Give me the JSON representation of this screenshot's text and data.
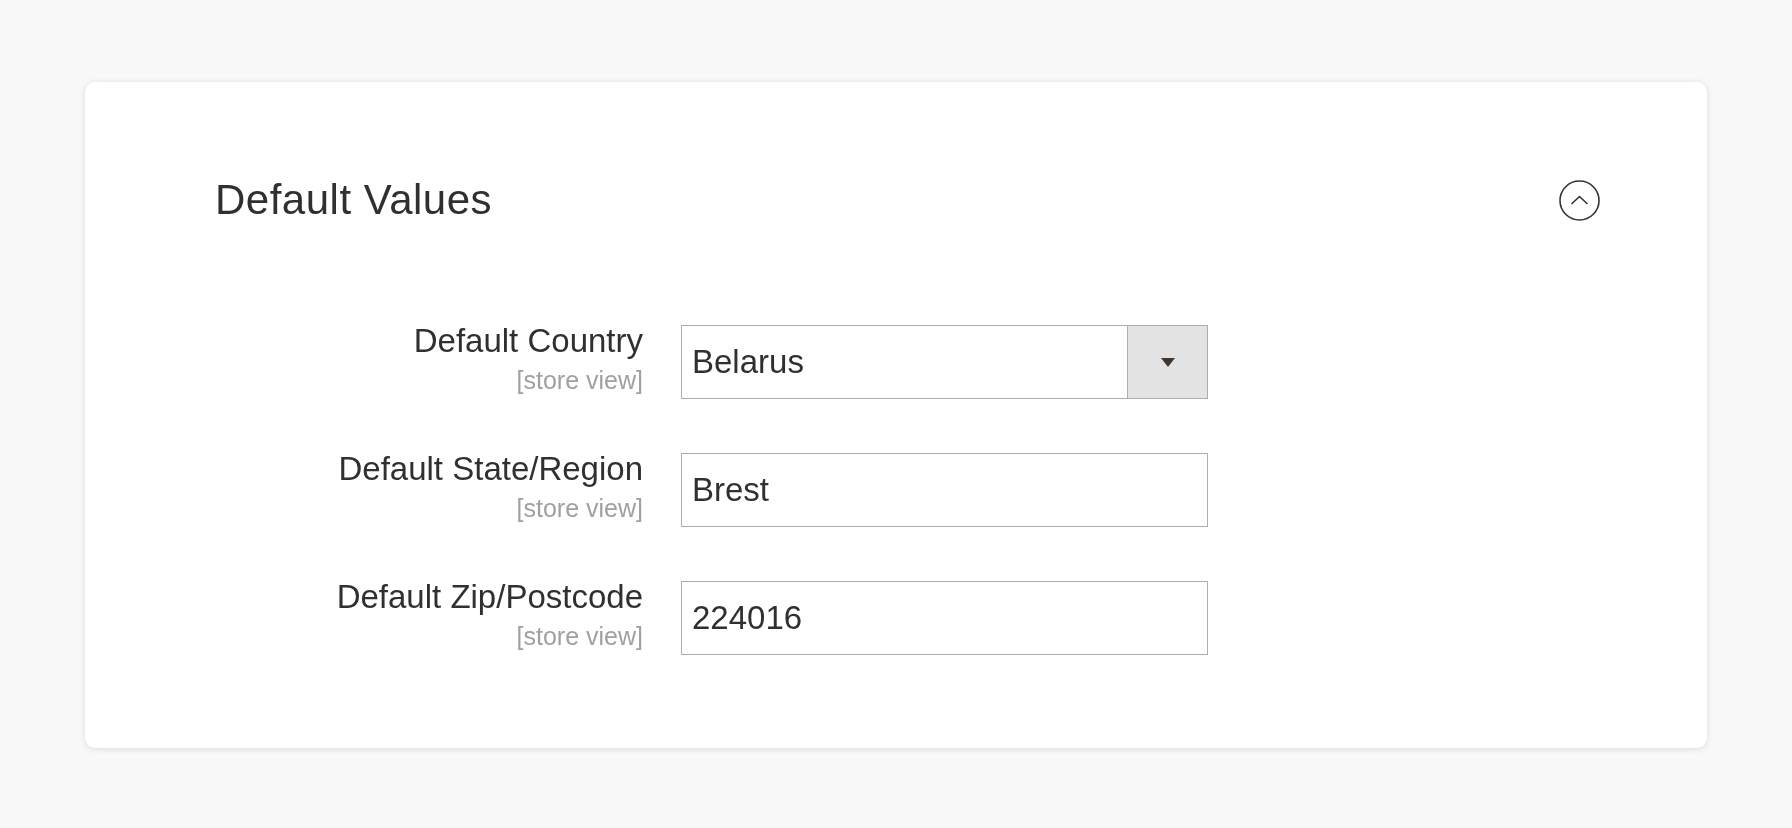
{
  "section": {
    "title": "Default Values",
    "expanded": true
  },
  "fields": [
    {
      "kind": "select",
      "label": "Default Country",
      "scope": "[store view]",
      "value": "Belarus"
    },
    {
      "kind": "text",
      "label": "Default State/Region",
      "scope": "[store view]",
      "value": "Brest"
    },
    {
      "kind": "text",
      "label": "Default Zip/Postcode",
      "scope": "[store view]",
      "value": "224016"
    }
  ]
}
